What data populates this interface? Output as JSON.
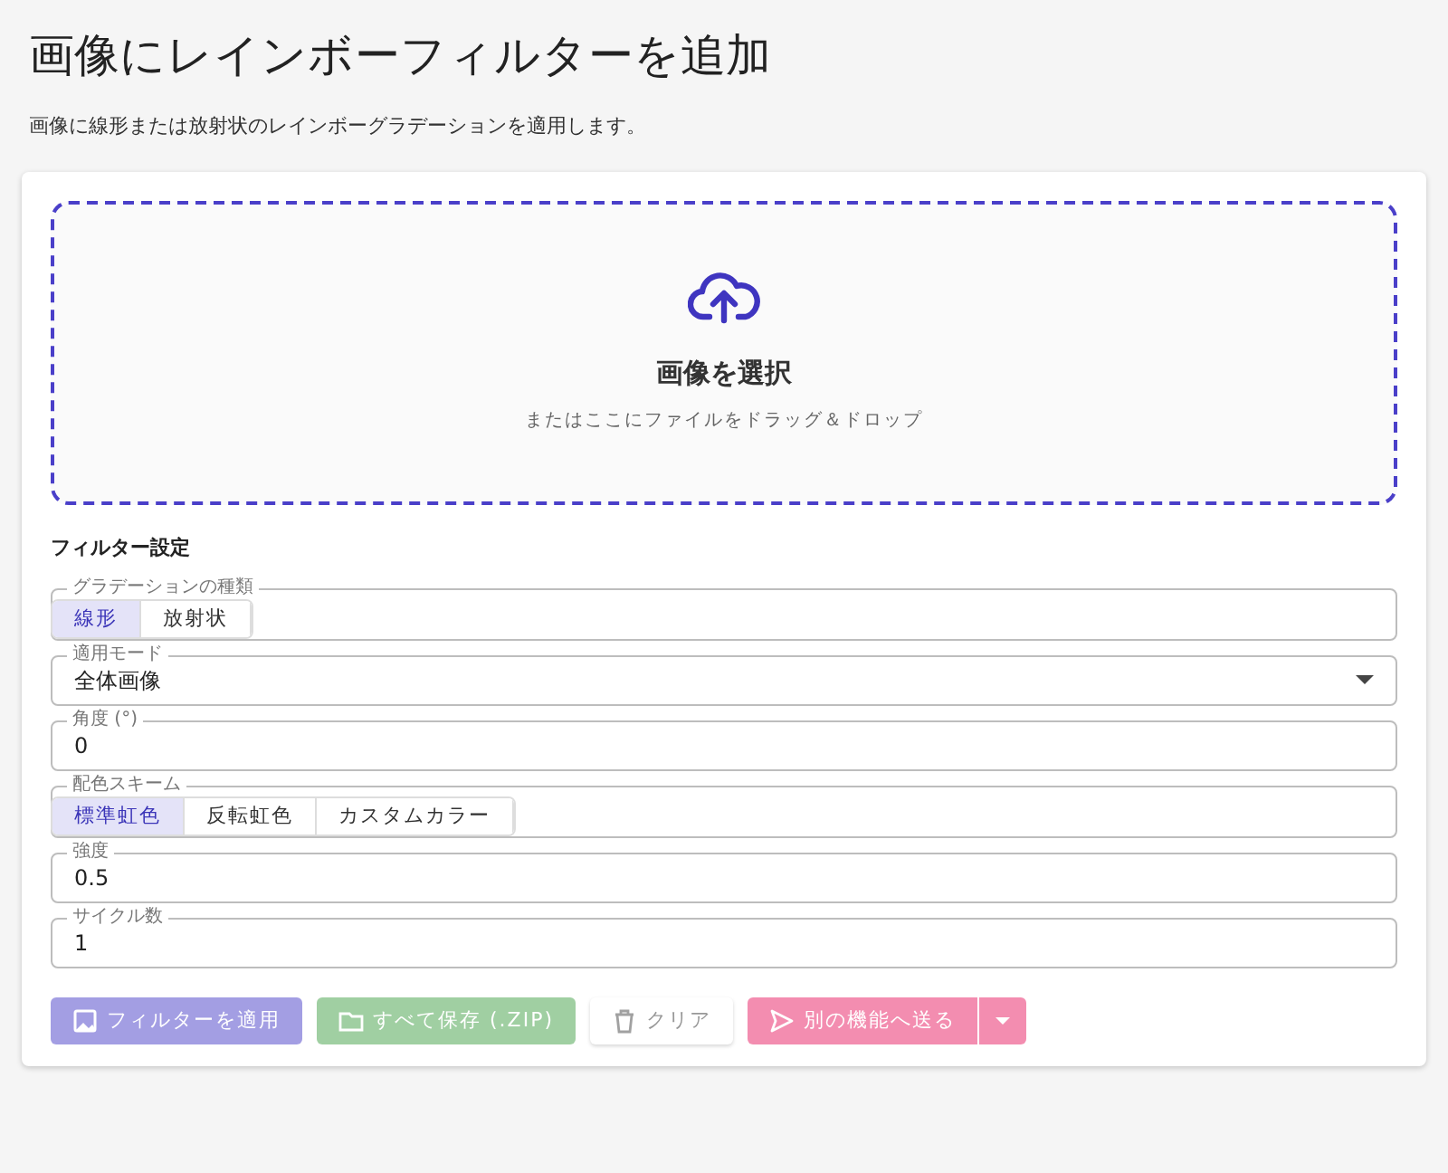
{
  "page": {
    "title": "画像にレインボーフィルターを追加",
    "description": "画像に線形または放射状のレインボーグラデーションを適用します。"
  },
  "upload": {
    "label": "画像を選択",
    "hint": "またはここにファイルをドラッグ＆ドロップ"
  },
  "settings": {
    "heading": "フィルター設定",
    "fields": [
      {
        "kind": "toggle",
        "label": "グラデーションの種類",
        "options": [
          {
            "label": "線形",
            "selected": true
          },
          {
            "label": "放射状",
            "selected": false
          }
        ]
      },
      {
        "kind": "select",
        "label": "適用モード",
        "value": "全体画像"
      },
      {
        "kind": "text",
        "label": "角度 (°)",
        "value": "0"
      },
      {
        "kind": "toggle",
        "label": "配色スキーム",
        "options": [
          {
            "label": "標準虹色",
            "selected": true
          },
          {
            "label": "反転虹色",
            "selected": false
          },
          {
            "label": "カスタムカラー",
            "selected": false
          }
        ]
      },
      {
        "kind": "text",
        "label": "強度",
        "value": "0.5"
      },
      {
        "kind": "text",
        "label": "サイクル数",
        "value": "1"
      }
    ]
  },
  "actions": [
    {
      "kind": "primary",
      "label": "フィルターを適用",
      "disabled": true
    },
    {
      "kind": "success",
      "label": "すべて保存 (.ZIP)",
      "disabled": true
    },
    {
      "kind": "plain",
      "label": "クリア",
      "disabled": true
    },
    {
      "kind": "danger",
      "label": "別の機能へ送る",
      "disabled": true
    }
  ]
}
